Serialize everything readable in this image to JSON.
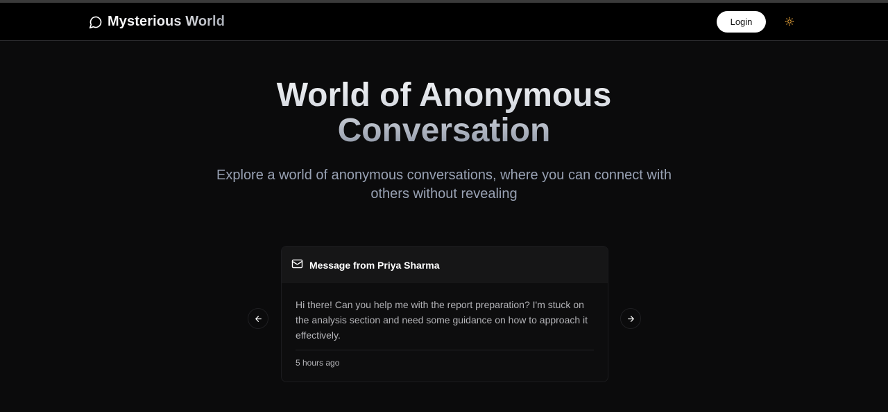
{
  "header": {
    "brand": "Mysterious World",
    "login_label": "Login",
    "theme_icon": "sun-icon"
  },
  "hero": {
    "title": "World of Anonymous Conversation",
    "subtitle": "Explore a world of anonymous conversations, where you can connect with others without revealing"
  },
  "carousel": {
    "current_message": {
      "title": "Message from Priya Sharma",
      "content": "Hi there! Can you help me with the report preparation? I'm stuck on the analysis section and need some guidance on how to approach it effectively.",
      "received": "5 hours ago"
    }
  },
  "colors": {
    "background": "#0b0b0c",
    "navbar": "#000000",
    "card_header": "#161617",
    "subtitle_text": "#98a1b3",
    "theme_icon": "#e8a33a"
  }
}
